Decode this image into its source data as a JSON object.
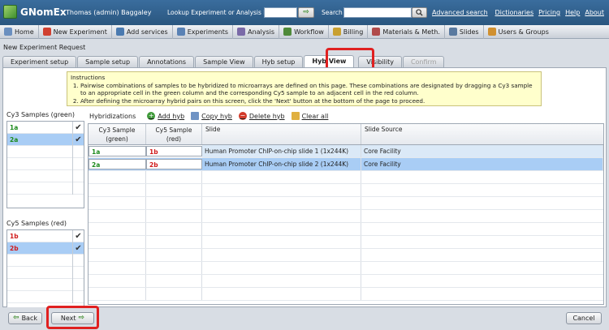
{
  "app": {
    "name": "GNomEx",
    "user": "Thomas (admin) Baggaley"
  },
  "top": {
    "lookup_label": "Lookup Experiment or Analysis by #",
    "lookup_value": "",
    "go_symbol": "⇨",
    "search_label": "Search",
    "search_value": "",
    "advanced_search": "Advanced search",
    "links": [
      "Dictionaries",
      "Pricing",
      "Help",
      "About"
    ]
  },
  "nav": [
    {
      "label": "Home",
      "icon": "home-icon",
      "color": "#6a8fbf"
    },
    {
      "label": "New Experiment",
      "icon": "new-experiment-icon",
      "color": "#d04030"
    },
    {
      "label": "Add services",
      "icon": "add-services-icon",
      "color": "#4a7ab0"
    },
    {
      "label": "Experiments",
      "icon": "experiments-icon",
      "color": "#5a82b5"
    },
    {
      "label": "Analysis",
      "icon": "analysis-icon",
      "color": "#7a6aa8"
    },
    {
      "label": "Workflow",
      "icon": "workflow-icon",
      "color": "#4f8a3a"
    },
    {
      "label": "Billing",
      "icon": "billing-icon",
      "color": "#c9a030"
    },
    {
      "label": "Materials & Meth.",
      "icon": "materials-icon",
      "color": "#b04a4a"
    },
    {
      "label": "Slides",
      "icon": "slides-icon",
      "color": "#5a7aa0"
    },
    {
      "label": "Users & Groups",
      "icon": "users-icon",
      "color": "#d09030"
    }
  ],
  "page_title": "New Experiment Request",
  "tabs": [
    "Experiment setup",
    "Sample setup",
    "Annotations",
    "Sample View",
    "Hyb setup",
    "Hyb View",
    "Visibility",
    "Confirm"
  ],
  "instructions": {
    "title": "Instructions",
    "items": [
      "Pairwise combinations of samples to be hybridized to microarrays are defined on this page. These combinations are designated by dragging a Cy3 sample to an appropriate cell in the green column and the corresponding Cy5 sample to an adjacent cell in the red column.",
      "After defining the microarray hybrid pairs on this screen, click the 'Next' button at the bottom of the page to proceed."
    ]
  },
  "cy3": {
    "label": "Cy3 Samples (green)",
    "items": [
      "1a",
      "2a"
    ]
  },
  "cy5": {
    "label": "Cy5 Samples (red)",
    "items": [
      "1b",
      "2b"
    ]
  },
  "check_mark": "✔",
  "toolbar": {
    "label": "Hybridizations",
    "add": "Add hyb",
    "copy": "Copy hyb",
    "delete": "Delete hyb",
    "clear": "Clear all"
  },
  "grid": {
    "headers": [
      "Cy3 Sample (green)",
      "Cy5 Sample (red)",
      "Slide",
      "Slide Source"
    ],
    "rows": [
      {
        "cy3": "1a",
        "cy5": "1b",
        "slide": "Human Promoter ChIP-on-chip slide 1 (1x244K)",
        "source": "Core Facility"
      },
      {
        "cy3": "2a",
        "cy5": "2b",
        "slide": "Human Promoter ChIP-on-chip slide 2 (1x244K)",
        "source": "Core Facility"
      }
    ]
  },
  "buttons": {
    "back": "Back",
    "next": "Next",
    "cancel": "Cancel"
  }
}
